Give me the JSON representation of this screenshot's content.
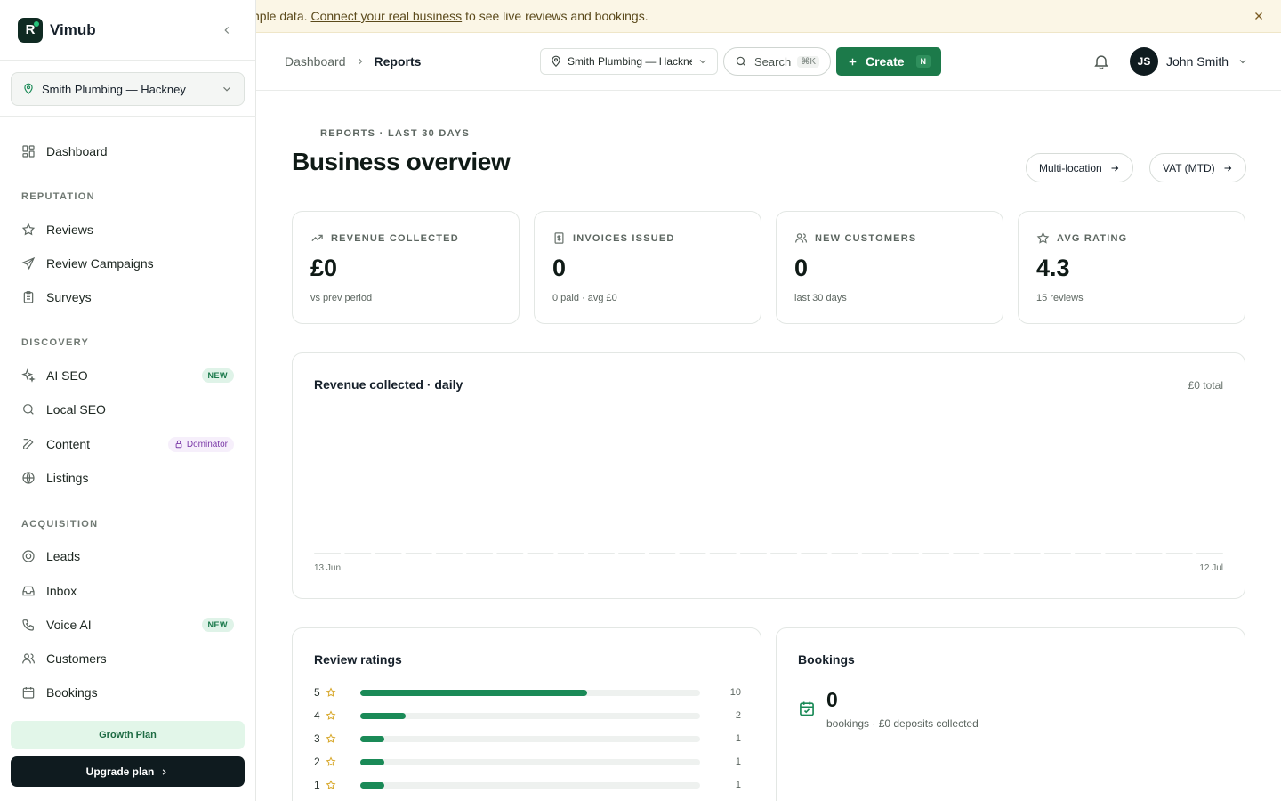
{
  "app": {
    "name": "Vimub",
    "logo_letter": "R"
  },
  "sidebar": {
    "location": "Smith Plumbing — Hackney",
    "dashboard": "Dashboard",
    "sections": {
      "reputation": "REPUTATION",
      "discovery": "DISCOVERY",
      "acquisition": "ACQUISITION"
    },
    "items": {
      "reviews": "Reviews",
      "review_campaigns": "Review Campaigns",
      "surveys": "Surveys",
      "ai_seo": "AI SEO",
      "local_seo": "Local SEO",
      "content": "Content",
      "listings": "Listings",
      "leads": "Leads",
      "inbox": "Inbox",
      "voice_ai": "Voice AI",
      "customers": "Customers",
      "bookings": "Bookings"
    },
    "badges": {
      "new": "NEW",
      "dominator": "Dominator"
    },
    "plan": "Growth Plan",
    "upgrade": "Upgrade plan"
  },
  "banner": {
    "prefix": "nple data.",
    "link": "Connect your real business",
    "suffix": "to see live reviews and bookings."
  },
  "topbar": {
    "breadcrumb": {
      "parent": "Dashboard",
      "current": "Reports"
    },
    "location": "Smith Plumbing — Hackney",
    "search": "Search",
    "search_kbd": "⌘K",
    "create": "Create",
    "create_kbd": "N",
    "user": {
      "initials": "JS",
      "name": "John Smith"
    }
  },
  "page": {
    "eyebrow": "REPORTS · LAST 30 DAYS",
    "title": "Business overview",
    "actions": {
      "multi_location": "Multi-location",
      "vat": "VAT (MTD)"
    }
  },
  "stats": [
    {
      "label": "REVENUE COLLECTED",
      "value": "£0",
      "sub": "vs prev period",
      "icon": "trending-up-icon"
    },
    {
      "label": "INVOICES ISSUED",
      "value": "0",
      "sub": "0 paid · avg £0",
      "icon": "invoice-icon"
    },
    {
      "label": "NEW CUSTOMERS",
      "value": "0",
      "sub": "last 30 days",
      "icon": "users-icon"
    },
    {
      "label": "AVG RATING",
      "value": "4.3",
      "sub": "15 reviews",
      "icon": "star-icon"
    }
  ],
  "chart_data": {
    "type": "bar",
    "title": "Revenue collected · daily",
    "total": "£0 total",
    "x_start": "13 Jun",
    "x_end": "12 Jul",
    "values": [
      0,
      0,
      0,
      0,
      0,
      0,
      0,
      0,
      0,
      0,
      0,
      0,
      0,
      0,
      0,
      0,
      0,
      0,
      0,
      0,
      0,
      0,
      0,
      0,
      0,
      0,
      0,
      0,
      0,
      0
    ],
    "color": "#e7eae8"
  },
  "ratings": {
    "title": "Review ratings",
    "rows": [
      {
        "stars": "5",
        "count": "10"
      },
      {
        "stars": "4",
        "count": "2"
      },
      {
        "stars": "3",
        "count": "1"
      },
      {
        "stars": "2",
        "count": "1"
      },
      {
        "stars": "1",
        "count": "1"
      }
    ],
    "max": 15
  },
  "bookings": {
    "title": "Bookings",
    "value": "0",
    "sub": "bookings · £0 deposits collected"
  },
  "colors": {
    "brand": "#1c7a4a",
    "dark": "#0f1b1f",
    "star": "#d8a92e"
  }
}
